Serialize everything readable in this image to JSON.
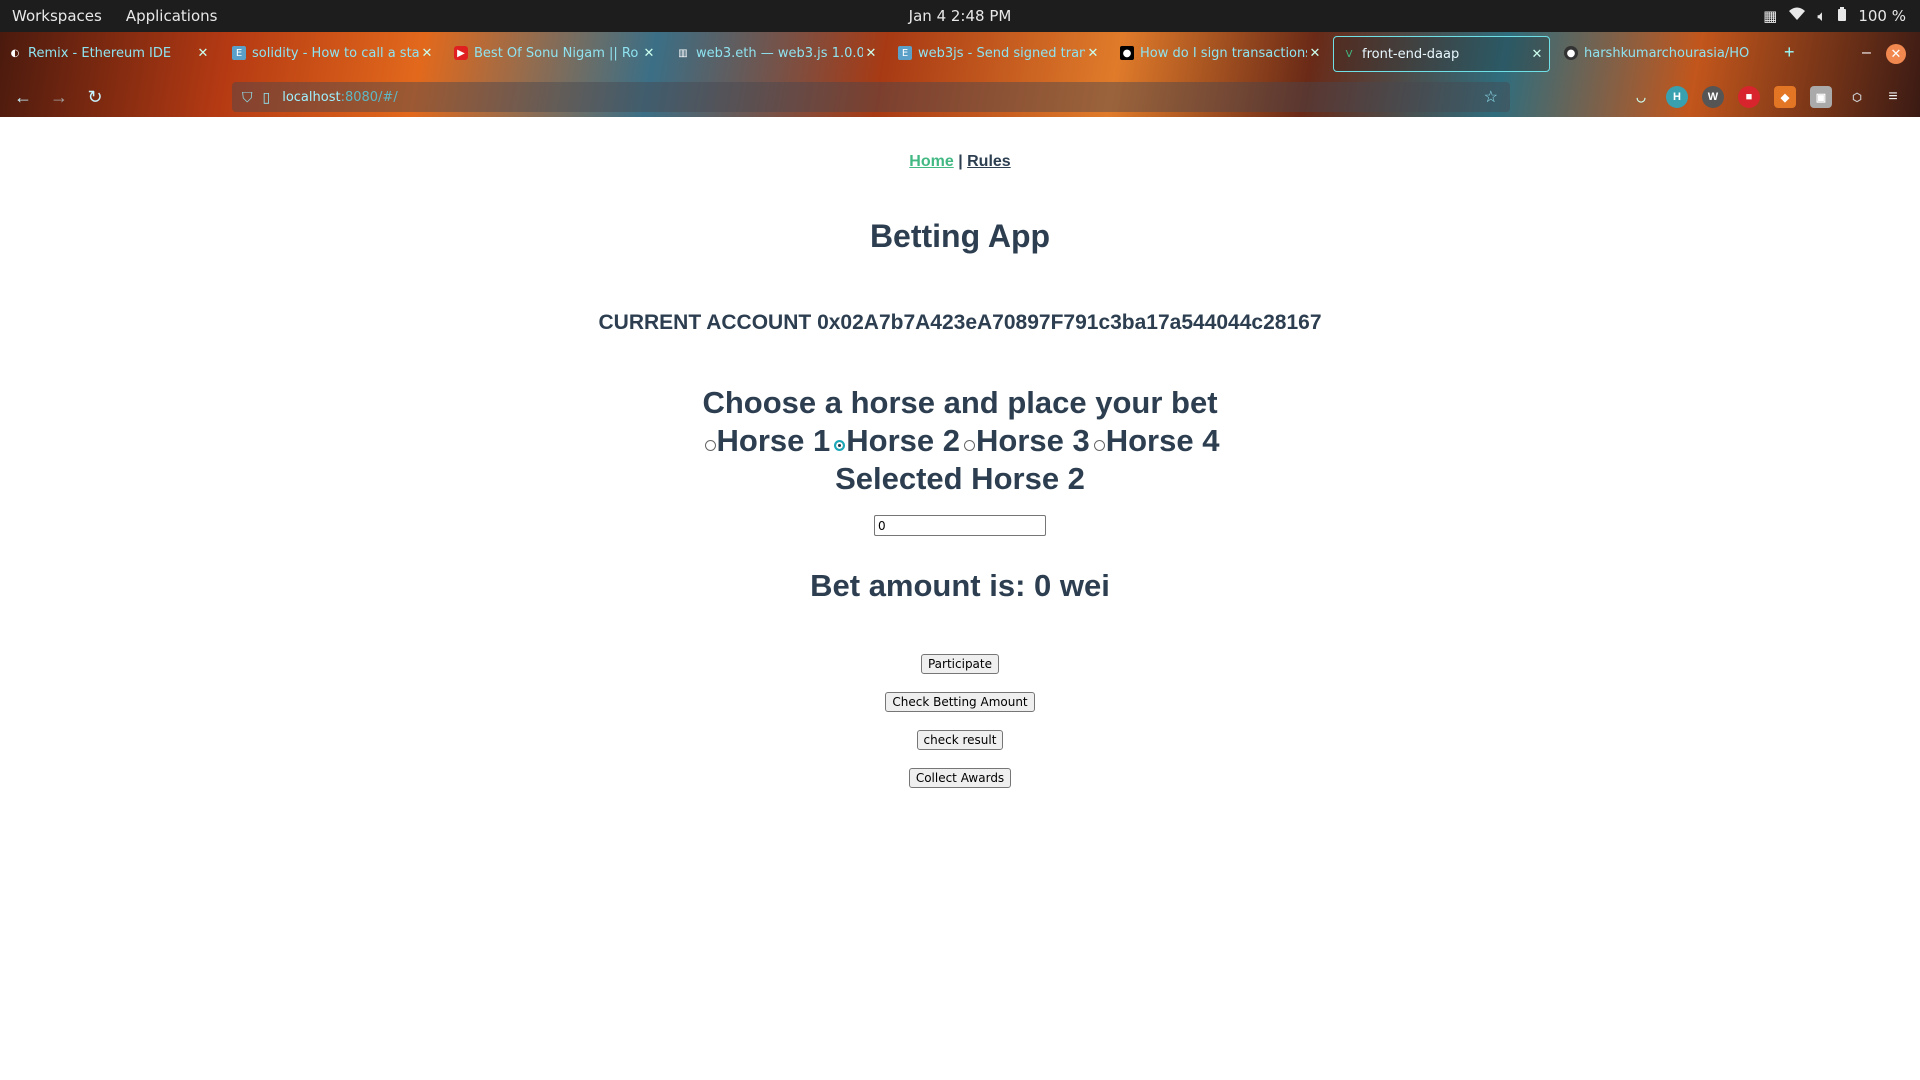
{
  "topbar": {
    "workspaces": "Workspaces",
    "applications": "Applications",
    "datetime": "Jan 4   2:48 PM",
    "battery": "100 %"
  },
  "tabs": [
    {
      "title": "Remix - Ethereum IDE",
      "icon": "remix-icon",
      "active": false
    },
    {
      "title": "solidity - How to call a sta",
      "icon": "eth-icon",
      "active": false
    },
    {
      "title": "Best Of Sonu Nigam || Ro",
      "icon": "youtube-icon",
      "active": false
    },
    {
      "title": "web3.eth — web3.js 1.0.0",
      "icon": "docs-icon",
      "active": false
    },
    {
      "title": "web3js - Send signed tran",
      "icon": "eth-icon",
      "active": false
    },
    {
      "title": "How do I sign transactions",
      "icon": "medium-icon",
      "active": false
    },
    {
      "title": "front-end-daap",
      "icon": "vue-icon",
      "active": true
    },
    {
      "title": "harshkumarchourasia/HO",
      "icon": "github-icon",
      "active": false
    }
  ],
  "address_bar": {
    "host": "localhost",
    "path": ":8080/#/"
  },
  "page": {
    "nav": {
      "home": "Home",
      "separator": "|",
      "rules": "Rules"
    },
    "title": "Betting App",
    "account_label": "CURRENT ACCOUNT",
    "account_address": "0x02A7b7A423eA70897F791c3ba17a544044c28167",
    "choose_heading": "Choose a horse and place your bet",
    "horses": [
      {
        "label": "Horse 1",
        "selected": false
      },
      {
        "label": "Horse 2",
        "selected": true
      },
      {
        "label": "Horse 3",
        "selected": false
      },
      {
        "label": "Horse 4",
        "selected": false
      }
    ],
    "selected_text": "Selected Horse 2",
    "bet_input_value": "0",
    "bet_amount_text": "Bet amount is: 0 wei",
    "buttons": {
      "participate": "Participate",
      "check_betting_amount": "Check Betting Amount",
      "check_result": "check result",
      "collect_awards": "Collect Awards"
    }
  },
  "colors": {
    "text": "#2c3e50",
    "link_active": "#42b983"
  }
}
